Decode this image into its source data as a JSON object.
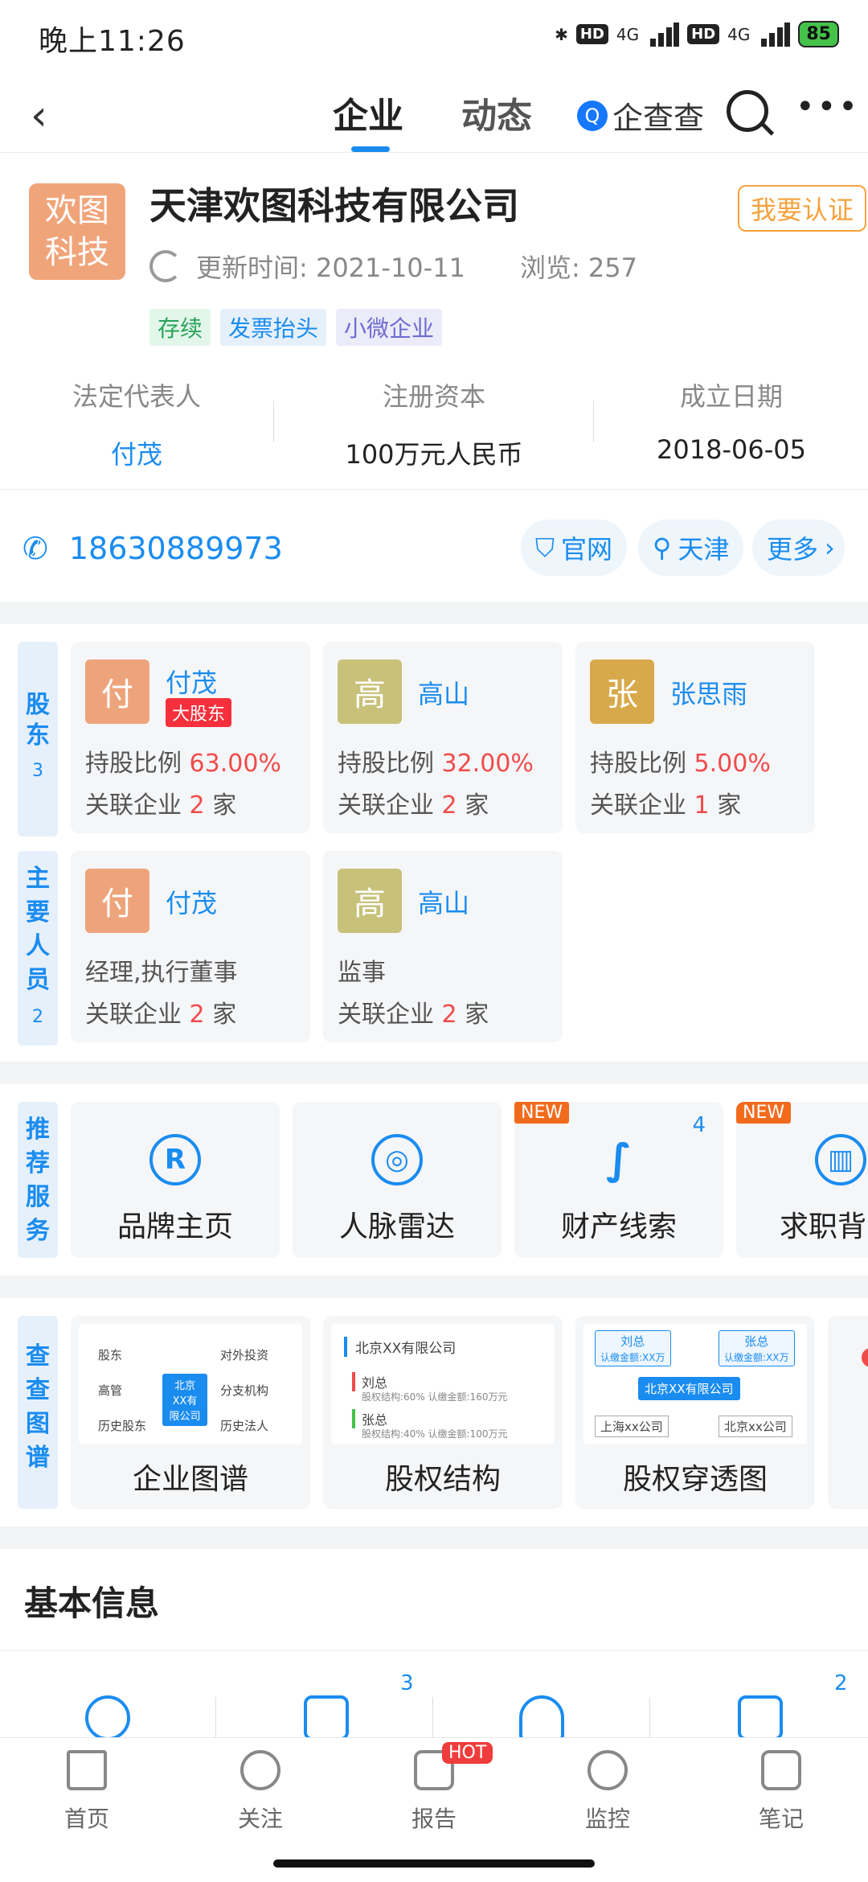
{
  "status": {
    "time": "晚上11:26",
    "hd": "HD",
    "net": "4G",
    "battery": "85"
  },
  "nav": {
    "back": "‹",
    "tab1": "企业",
    "tab2": "动态",
    "brand": "企查查",
    "more": "•••"
  },
  "company": {
    "logo_line1": "欢图",
    "logo_line2": "科技",
    "name": "天津欢图科技有限公司",
    "certify": "我要认证",
    "update": "更新时间: 2021-10-11",
    "views": "浏览: 257",
    "tags": [
      "存续",
      "发票抬头",
      "小微企业"
    ]
  },
  "info": [
    {
      "k": "法定代表人",
      "v": "付茂"
    },
    {
      "k": "注册资本",
      "v": "100万元人民币"
    },
    {
      "k": "成立日期",
      "v": "2018-06-05"
    }
  ],
  "contact": {
    "phone": "18630889973",
    "site": "官网",
    "city": "天津",
    "more": "更多"
  },
  "shareholders": {
    "label": "股东",
    "count": "3",
    "items": [
      {
        "av": "付",
        "name": "付茂",
        "badge": "大股东",
        "ratio_label": "持股比例",
        "ratio": "63.00%",
        "rel_label": "关联企业",
        "rel": "2",
        "unit": "家",
        "color": "#eea47b"
      },
      {
        "av": "高",
        "name": "高山",
        "ratio_label": "持股比例",
        "ratio": "32.00%",
        "rel_label": "关联企业",
        "rel": "2",
        "unit": "家",
        "color": "#c8c17a"
      },
      {
        "av": "张",
        "name": "张思雨",
        "ratio_label": "持股比例",
        "ratio": "5.00%",
        "rel_label": "关联企业",
        "rel": "1",
        "unit": "家",
        "color": "#d8a94a"
      }
    ]
  },
  "staff": {
    "label": "主要人员",
    "count": "2",
    "items": [
      {
        "av": "付",
        "name": "付茂",
        "role": "经理,执行董事",
        "rel_label": "关联企业",
        "rel": "2",
        "unit": "家"
      },
      {
        "av": "高",
        "name": "高山",
        "role": "监事",
        "rel_label": "关联企业",
        "rel": "2",
        "unit": "家"
      }
    ]
  },
  "services": {
    "label": "推荐服务",
    "items": [
      {
        "icon": "R",
        "label": "品牌主页"
      },
      {
        "icon": "◎",
        "label": "人脉雷达"
      },
      {
        "icon": "∫",
        "label": "财产线索",
        "badge": "NEW",
        "count": "4"
      },
      {
        "icon": "▥",
        "label": "求职背",
        "badge": "NEW"
      }
    ]
  },
  "graphs": {
    "label": "查查图谱",
    "items": [
      {
        "label": "企业图谱"
      },
      {
        "label": "股权结构"
      },
      {
        "label": "股权穿透图"
      }
    ],
    "g1": {
      "center": "北京XX有限公司",
      "n1": "股东",
      "n2": "对外投资",
      "n3": "高管",
      "n4": "分支机构",
      "n5": "历史股东",
      "n6": "历史法人"
    },
    "g2": {
      "title": "北京XX有限公司",
      "p1": "刘总",
      "p1s": "股权结构:60% 认缴金额:160万元",
      "p2": "张总",
      "p2s": "股权结构:40% 认缴金额:100万元"
    },
    "g3": {
      "a": "刘总",
      "as": "认缴金额:XX万",
      "b": "张总",
      "bs": "认缴金额:XX万",
      "c": "北京XX有限公司",
      "d": "上海xx公司",
      "e": "北京xx公司"
    }
  },
  "basic": {
    "title": "基本信息",
    "count1": "3",
    "count2": "2"
  },
  "tabbar": [
    "首页",
    "关注",
    "报告",
    "监控",
    "笔记"
  ],
  "hot": "HOT"
}
